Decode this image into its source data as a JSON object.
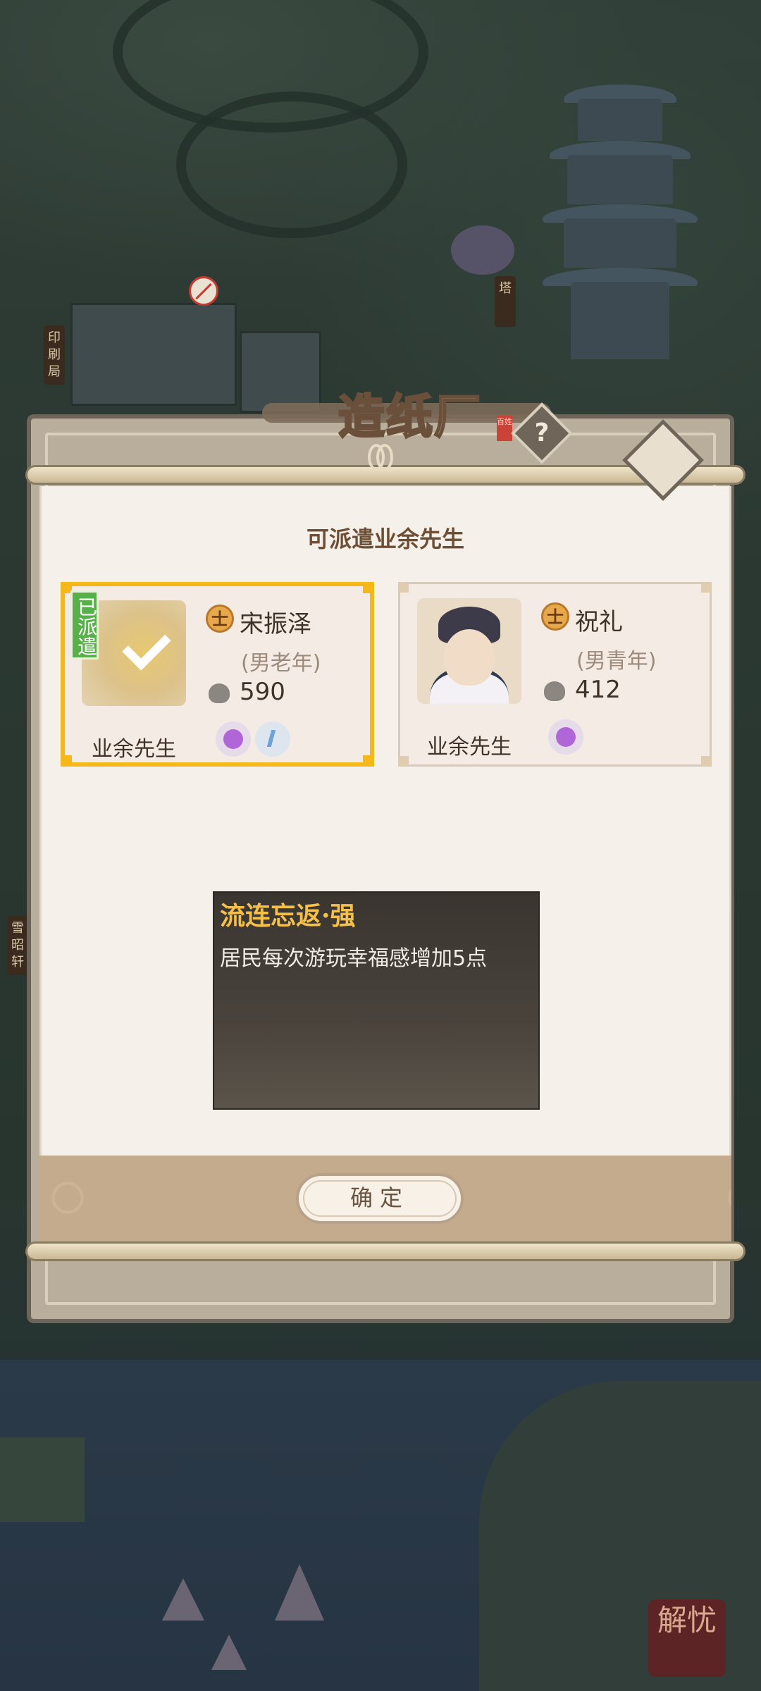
{
  "map": {
    "sign_printing": "印刷局",
    "sign_tower": "塔",
    "sign_xuezhao": "雪昭轩",
    "seal_text": "解忧"
  },
  "panel": {
    "title": "造纸厂",
    "title_seal": "百姓",
    "help_symbol": "?",
    "heading": "可派遣业余先生"
  },
  "workers": [
    {
      "rank": "士",
      "name": "宋振泽",
      "age_label": "(男老年)",
      "power": "590",
      "role": "业余先生",
      "dispatched_tag": "已派遣",
      "selected": true,
      "skills": [
        "purple-skill-icon",
        "blue-skill-icon"
      ]
    },
    {
      "rank": "士",
      "name": "祝礼",
      "age_label": "(男青年)",
      "power": "412",
      "role": "业余先生",
      "selected": false,
      "skills": [
        "purple-skill-icon"
      ]
    }
  ],
  "skill": {
    "title": "流连忘返·强",
    "description": "居民每次游玩幸福感增加5点"
  },
  "confirm_label": "确定",
  "colors": {
    "selected_border": "#f6b818",
    "dispatched_tag": "#58b04a",
    "skill_title": "#f4c04a",
    "paper": "#f5f1ea"
  }
}
